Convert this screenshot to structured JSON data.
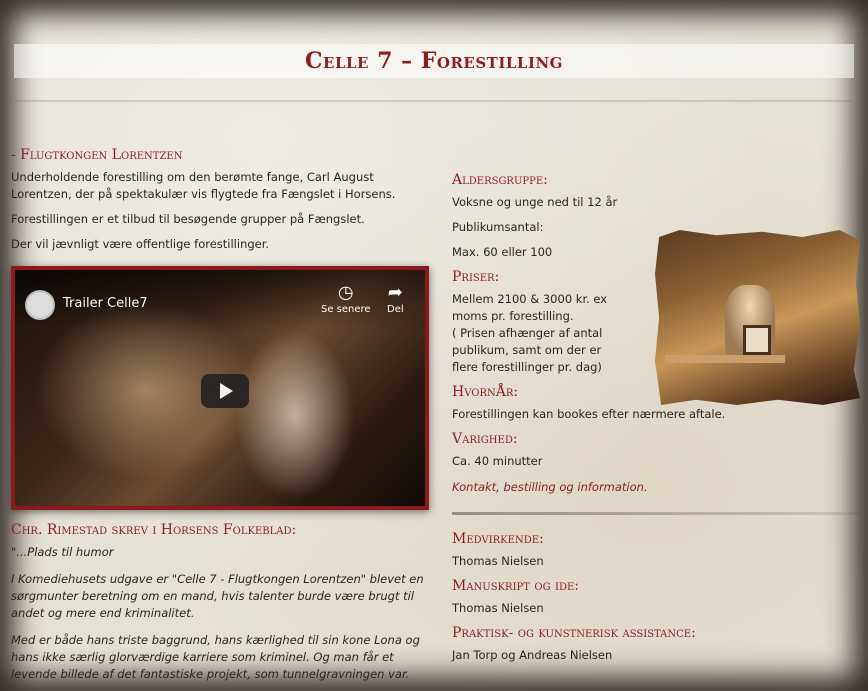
{
  "page": {
    "title": "Celle 7 – Forestilling"
  },
  "left": {
    "heading": "- Flugtkongen Lorentzen",
    "intro": "Underholdende forestilling om den berømte fange, Carl August Lorentzen, der på spektakulær vis flygtede fra Fængslet i Horsens.",
    "offer": "Forestillingen er et tilbud til besøgende grupper på Fængslet.",
    "public": "Der vil jævnligt være offentlige forestillinger.",
    "video": {
      "title": "Trailer Celle7",
      "watch_later": "Se senere",
      "share": "Del"
    },
    "review_heading": "Chr. Rimestad skrev i Horsens Folkeblad:",
    "quote_title": "\"...Plads til humor",
    "quote_p1": "I Komediehusets udgave er \"Celle 7 - Flugtkongen Lorentzen\" blevet en sørgmunter beretning om en mand, hvis talenter burde være brugt til andet og mere end kriminalitet.",
    "quote_p2": "Med er både hans triste baggrund, hans kærlighed til sin kone Lona og hans ikke særlig glorværdige karriere som kriminel. Og man får et levende billede af det fantastiske projekt, som tunnelgravningen var."
  },
  "right": {
    "age_heading": "Aldersgruppe:",
    "age_value": "Voksne og unge ned til 12 år",
    "audience_label": "Publikumsantal:",
    "audience_value": "Max. 60 eller 100",
    "price_heading": "Priser:",
    "price_value": "Mellem 2100 & 3000 kr. ex moms pr. forestilling.",
    "price_note": "( Prisen afhænger af antal publikum, samt om der er flere forestillinger pr. dag)",
    "when_heading": "HvornÅr:",
    "when_value": "Forestillingen kan bookes efter nærmere aftale.",
    "duration_heading": "Varighed:",
    "duration_value": "Ca. 40 minutter",
    "contact_link": "Kontakt, bestilling og information.",
    "cast_heading": "Medvirkende:",
    "cast_value": "Thomas Nielsen",
    "script_heading": "Manuskript og ide:",
    "script_value": "Thomas Nielsen",
    "assist_heading": "Praktisk- og kunstnerisk assistance:",
    "assist_value": "Jan Torp og Andreas Nielsen"
  },
  "colors": {
    "accent": "#8e1d1d",
    "text": "#2a2420",
    "paper": "#e6e1d6"
  },
  "icons": [
    "clock-icon",
    "share-icon",
    "play-icon",
    "channel-avatar"
  ]
}
